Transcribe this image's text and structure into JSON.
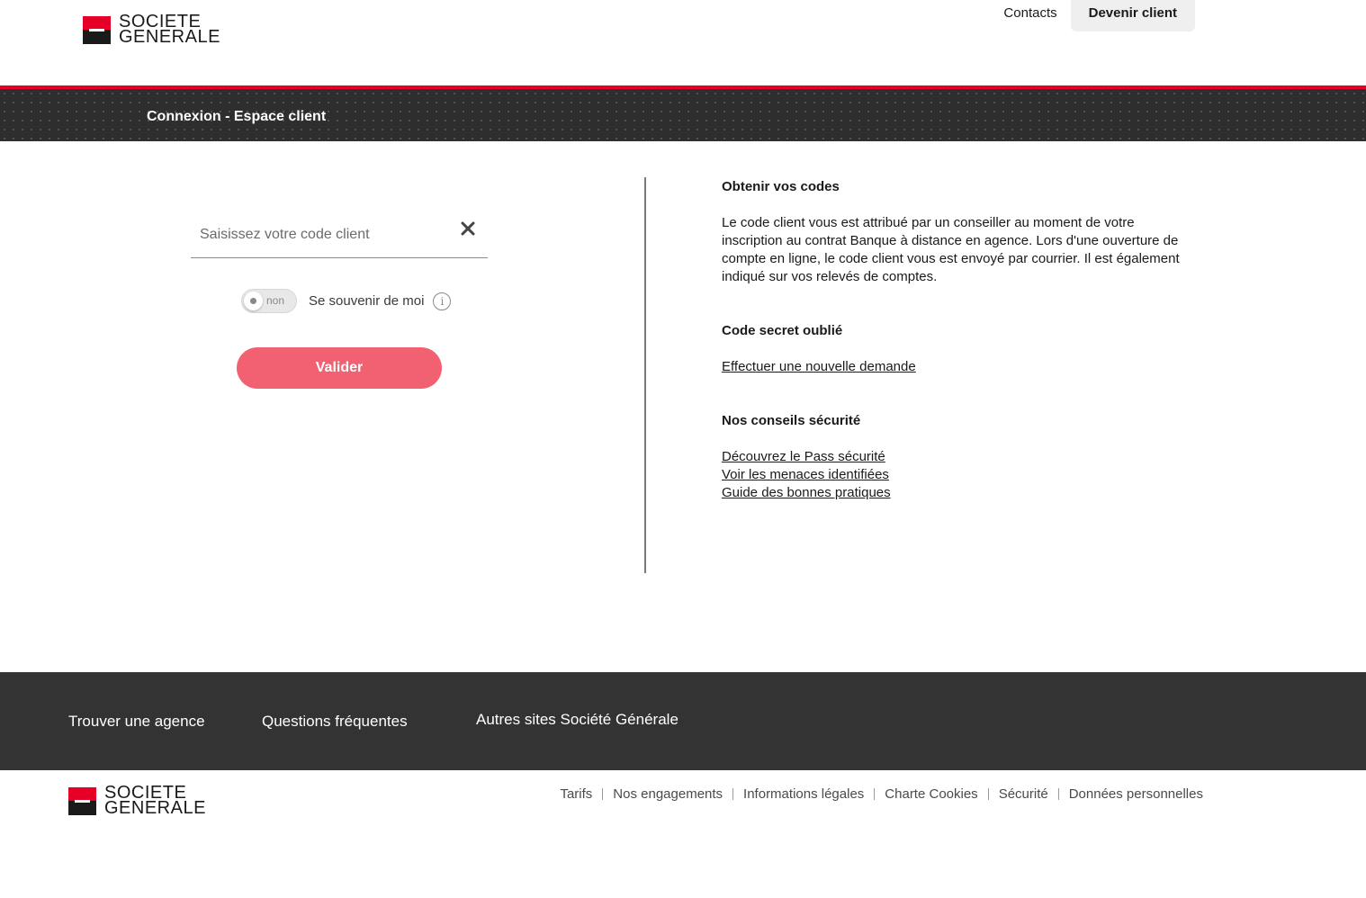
{
  "brand": {
    "line1": "SOCIETE",
    "line2": "GENERALE",
    "red": "#e60028",
    "black": "#1a1a1a"
  },
  "nav": {
    "contacts": "Contacts",
    "devenir_client": "Devenir client"
  },
  "banner": {
    "title": "Connexion - Espace client"
  },
  "login": {
    "placeholder": "Saisissez votre code client",
    "value": "",
    "toggle_state": "non",
    "remember_label": "Se souvenir de moi",
    "info_glyph": "i",
    "submit_label": "Valider",
    "submit_color": "#f26172"
  },
  "info": {
    "codes_title": "Obtenir vos codes",
    "codes_text": "Le code client vous est attribué par un conseiller au moment de votre inscription au contrat Banque à distance en agence. Lors d'une ouverture de compte en ligne, le code client vous est envoyé par courrier. Il est également indiqué sur vos relevés de comptes.",
    "secret_title": "Code secret oublié",
    "secret_link": "Effectuer une nouvelle demande",
    "security_title": "Nos conseils sécurité",
    "security_links": [
      "Découvrez le Pass sécurité",
      "Voir les menaces identifiées",
      "Guide des bonnes pratiques"
    ]
  },
  "footer_band": {
    "agence": "Trouver une agence",
    "questions": "Questions fréquentes",
    "autres": "Autres sites Société Générale"
  },
  "footer_links": [
    "Tarifs",
    "Nos engagements",
    "Informations légales",
    "Charte Cookies",
    "Sécurité",
    "Données personnelles"
  ]
}
